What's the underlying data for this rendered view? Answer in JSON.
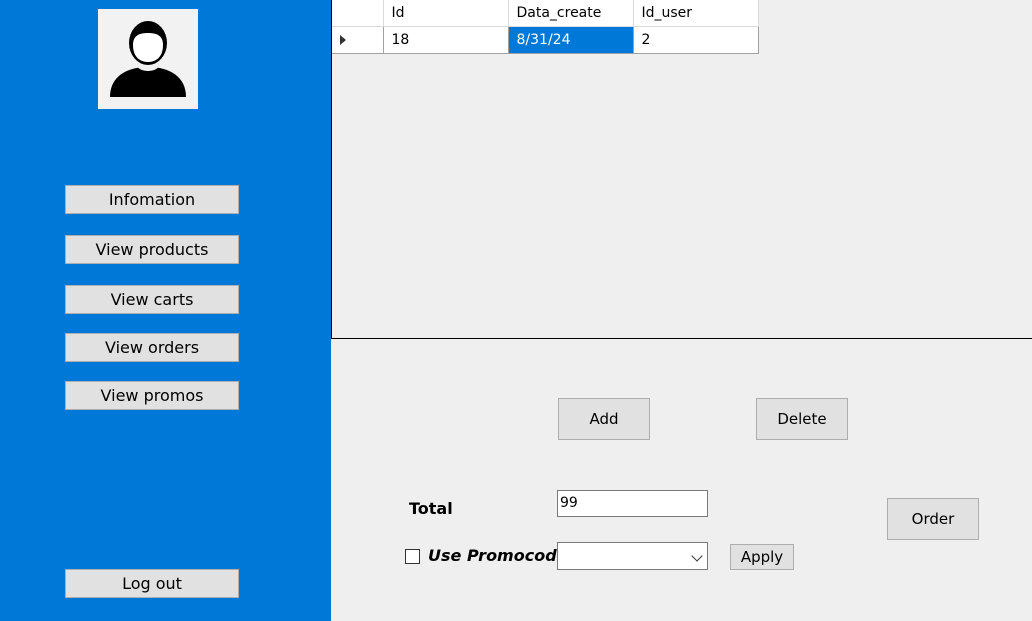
{
  "sidebar": {
    "avatar_icon": "user-avatar-icon",
    "items": [
      {
        "label": "Infomation"
      },
      {
        "label": "View products"
      },
      {
        "label": "View carts"
      },
      {
        "label": "View orders"
      },
      {
        "label": "View promos"
      }
    ],
    "logout_label": "Log out",
    "background_color": "#0078d7"
  },
  "grid": {
    "columns": [
      "Id",
      "Data_create",
      "Id_user"
    ],
    "rows": [
      {
        "id": "18",
        "date_create": "8/31/24",
        "id_user": "2"
      }
    ],
    "selection_color": "#0078d7"
  },
  "actions": {
    "add_label": "Add",
    "delete_label": "Delete"
  },
  "order": {
    "total_label": "Total",
    "total_value": "99",
    "use_promocode_label": "Use Promocode",
    "use_promocode_checked": false,
    "promocode_selected": "",
    "apply_label": "Apply",
    "order_label": "Order"
  }
}
